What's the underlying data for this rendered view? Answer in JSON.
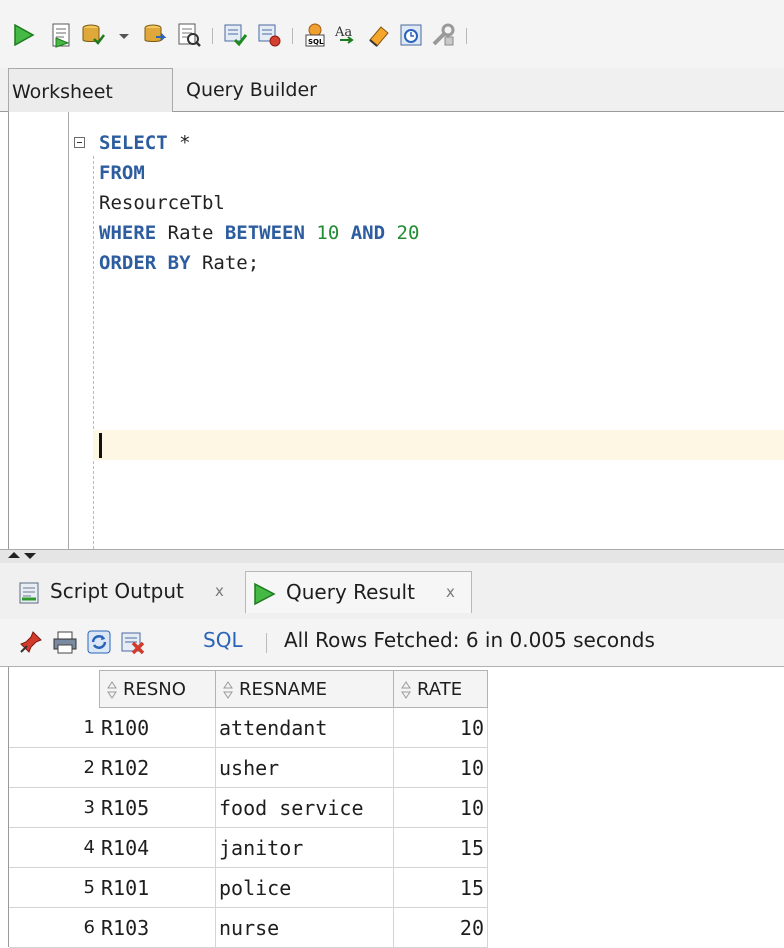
{
  "toolbar": {
    "icons": [
      "run-statement-icon",
      "run-script-icon",
      "commit-icon",
      "dropdown-arrow-icon",
      "rollback-icon",
      "explain-plan-icon",
      "autotrace-icon",
      "sql-tuning-icon",
      "sql-history-icon",
      "to-upper-lower-icon",
      "clear-eraser-icon",
      "history-clock-icon",
      "tools-wrench-icon"
    ]
  },
  "editor_tabs": {
    "worksheet": "Worksheet",
    "query_builder": "Query Builder"
  },
  "editor": {
    "line1": {
      "kw": "SELECT",
      "rest": " *"
    },
    "line2": {
      "kw": "FROM"
    },
    "line3": {
      "text": "ResourceTbl"
    },
    "line4": {
      "kw1": "WHERE",
      "t1": " Rate ",
      "kw2": "BETWEEN",
      "n1": "10",
      "kw3": "AND",
      "n2": "20"
    },
    "line5": {
      "kw1": "ORDER",
      "kw2": "BY",
      "rest": " Rate;"
    }
  },
  "output_tabs": {
    "script_output": "Script Output",
    "query_result": "Query Result",
    "close": "x"
  },
  "result_toolbar": {
    "sql_link": "SQL",
    "status": "All Rows Fetched: 6 in 0.005 seconds"
  },
  "grid": {
    "columns": [
      "RESNO",
      "RESNAME",
      "RATE"
    ],
    "rows": [
      {
        "n": "1",
        "resno": "R100",
        "resname": "attendant",
        "rate": "10"
      },
      {
        "n": "2",
        "resno": "R102",
        "resname": "usher",
        "rate": "10"
      },
      {
        "n": "3",
        "resno": "R105",
        "resname": "food service",
        "rate": "10"
      },
      {
        "n": "4",
        "resno": "R104",
        "resname": "janitor",
        "rate": "15"
      },
      {
        "n": "5",
        "resno": "R101",
        "resname": "police",
        "rate": "15"
      },
      {
        "n": "6",
        "resno": "R103",
        "resname": "nurse",
        "rate": "20"
      }
    ]
  },
  "colors": {
    "keyword": "#2d5d9f",
    "number": "#218d33",
    "run": "#3aa83a",
    "link": "#2a64b8",
    "current_line": "#fdf7e4"
  }
}
